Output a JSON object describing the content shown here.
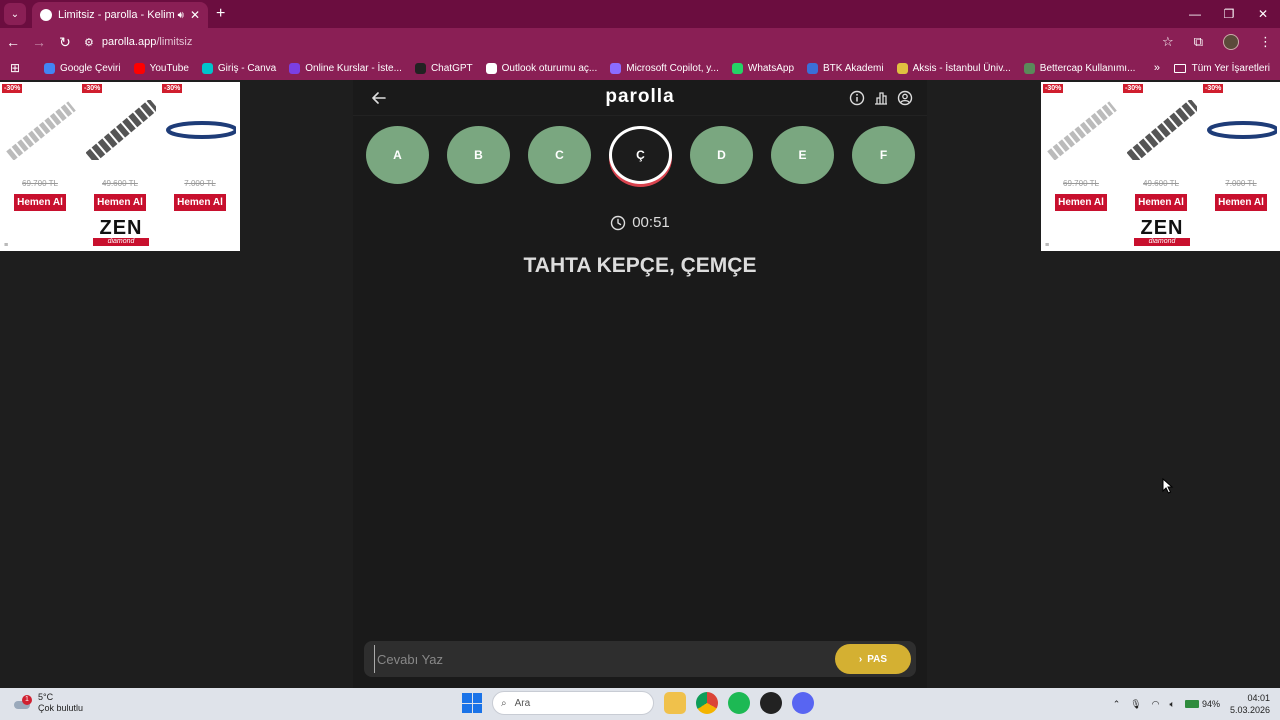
{
  "browser": {
    "tab": {
      "title": "Limitsiz - parolla - Kelime oyunu"
    },
    "url": {
      "host": "parolla.app",
      "path": "/limitsiz"
    },
    "bookmarks": [
      {
        "label": "Google Çeviri",
        "color": "#4285f4"
      },
      {
        "label": "YouTube",
        "color": "#ff0000"
      },
      {
        "label": "Giriş - Canva",
        "color": "#00c4cc"
      },
      {
        "label": "Online Kurslar - İste...",
        "color": "#7b3fe4"
      },
      {
        "label": "ChatGPT",
        "color": "#222222"
      },
      {
        "label": "Outlook oturumu aç...",
        "color": "#ffffff"
      },
      {
        "label": "Microsoft Copilot, y...",
        "color": "#8b6cff"
      },
      {
        "label": "WhatsApp",
        "color": "#25d366"
      },
      {
        "label": "BTK Akademi",
        "color": "#3a6fd8"
      },
      {
        "label": "Aksis - İstanbul Üniv...",
        "color": "#e0c040"
      },
      {
        "label": "Bettercap Kullanımı...",
        "color": "#5a8a5a"
      }
    ],
    "all_bookmarks": "Tüm Yer İşaretleri"
  },
  "ads": {
    "badge": "-30%",
    "prices": [
      "69.700 TL",
      "49.600 TL",
      "7.000 TL"
    ],
    "buy_label": "Hemen Al",
    "brand": "ZEN",
    "brand_sub": "diamond"
  },
  "app": {
    "title": "parolla",
    "letters": [
      "A",
      "B",
      "C",
      "Ç",
      "D",
      "E",
      "F"
    ],
    "active_letter": "Ç",
    "timer": "00:51",
    "question": "TAHTA KEPÇE, ÇEMÇE",
    "answer_placeholder": "Cevabı Yaz",
    "pass_label": "PAS",
    "colors": {
      "correct": "#7aa780",
      "pass": "#d4b032",
      "active_ring": "#d9434e"
    }
  },
  "taskbar": {
    "weather_temp": "5°C",
    "weather_desc": "Çok bulutlu",
    "weather_badge": "1",
    "search_placeholder": "Ara",
    "battery": "94%",
    "time": "04:01",
    "date": "5.03.2026"
  }
}
